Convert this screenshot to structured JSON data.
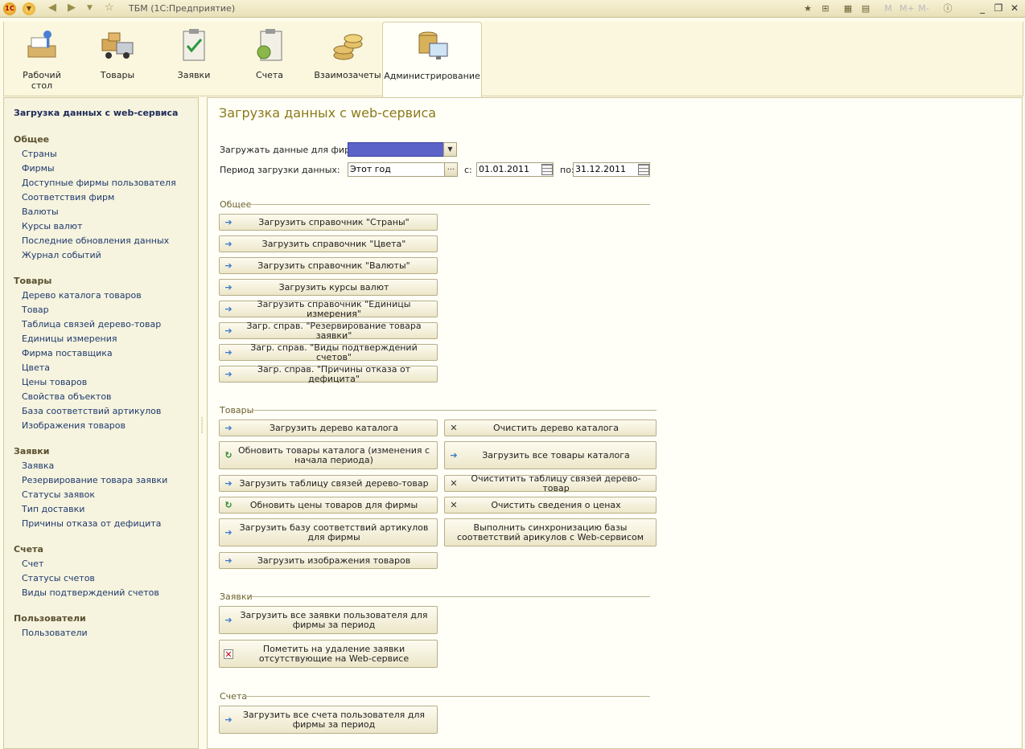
{
  "window": {
    "title": "ТБМ  (1С:Предприятие)"
  },
  "sections": [
    {
      "label": "Рабочий стол",
      "icon": "desktop-icon"
    },
    {
      "label": "Товары",
      "icon": "truck-icon"
    },
    {
      "label": "Заявки",
      "icon": "clipboard-icon"
    },
    {
      "label": "Счета",
      "icon": "invoice-icon"
    },
    {
      "label": "Взаимозачеты",
      "icon": "coins-icon"
    },
    {
      "label": "Администрирование",
      "icon": "admin-icon"
    }
  ],
  "active_section": "Администрирование",
  "nav": {
    "title": "Загрузка данных с web-сервиса",
    "groups": [
      {
        "title": "Общее",
        "items": [
          "Страны",
          "Фирмы",
          "Доступные фирмы пользователя",
          "Соответствия фирм",
          "Валюты",
          "Курсы валют",
          "Последние обновления данных",
          "Журнал событий"
        ]
      },
      {
        "title": "Товары",
        "items": [
          "Дерево каталога товаров",
          "Товар",
          "Таблица связей дерево-товар",
          "Единицы измерения",
          "Фирма поставщика",
          "Цвета",
          "Цены товаров",
          "Свойства объектов",
          "База соответствий артикулов",
          "Изображения товаров"
        ]
      },
      {
        "title": "Заявки",
        "items": [
          "Заявка",
          "Резервирование товара заявки",
          "Статусы заявок",
          "Тип доставки",
          "Причины отказа от дефицита"
        ]
      },
      {
        "title": "Счета",
        "items": [
          "Счет",
          "Статусы счетов",
          "Виды подтверждений счетов"
        ]
      },
      {
        "title": "Пользователи",
        "items": [
          "Пользователи"
        ]
      }
    ]
  },
  "main": {
    "title": "Загрузка данных с web-сервиса",
    "firm_label": "Загружать данные для фирмы:",
    "firm_value": "",
    "period_label": "Период загрузки данных:",
    "period_value": "Этот год",
    "select_btn": "...",
    "from_label": "с:",
    "from_date": "01.01.2011",
    "to_label": "по:",
    "to_date": "31.12.2011",
    "general": {
      "title": "Общее",
      "buttons": [
        "Загрузить справочник \"Страны\"",
        "Загрузить справочник \"Цвета\"",
        "Загрузить справочник \"Валюты\"",
        "Загрузить курсы валют",
        "Загрузить справочник \"Единицы измерения\"",
        "Загр. справ. \"Резервирование товара заявки\"",
        "Загр. справ. \"Виды подтверждений счетов\"",
        "Загр. справ. \"Причины отказа от дефицита\""
      ]
    },
    "goods": {
      "title": "Товары",
      "left": [
        "Загрузить дерево каталога",
        "Обновить товары каталога (изменения с начала периода)",
        "Загрузить таблицу связей дерево-товар",
        "Обновить цены товаров для фирмы",
        "Загрузить базу соответствий артикулов для фирмы",
        "Загрузить изображения товаров"
      ],
      "right": [
        "Очистить дерево каталога",
        "Загрузить все товары каталога",
        "Очиститить таблицу связей дерево-товар",
        "Очистить сведения о ценах",
        "Выполнить синхронизацию базы соответствий арикулов с Web-сервисом"
      ]
    },
    "orders": {
      "title": "Заявки",
      "buttons": [
        "Загрузить все заявки пользователя для фирмы за период",
        "Пометить на удаление заявки отсутствующие на Web-сервисе"
      ]
    },
    "invoices": {
      "title": "Счета",
      "buttons": [
        "Загрузить все счета пользователя для фирмы за период"
      ]
    }
  },
  "colors": {
    "accent_title": "#8a7a18",
    "nav_link": "#1e3a6e",
    "firm_field": "#5c63c8"
  }
}
